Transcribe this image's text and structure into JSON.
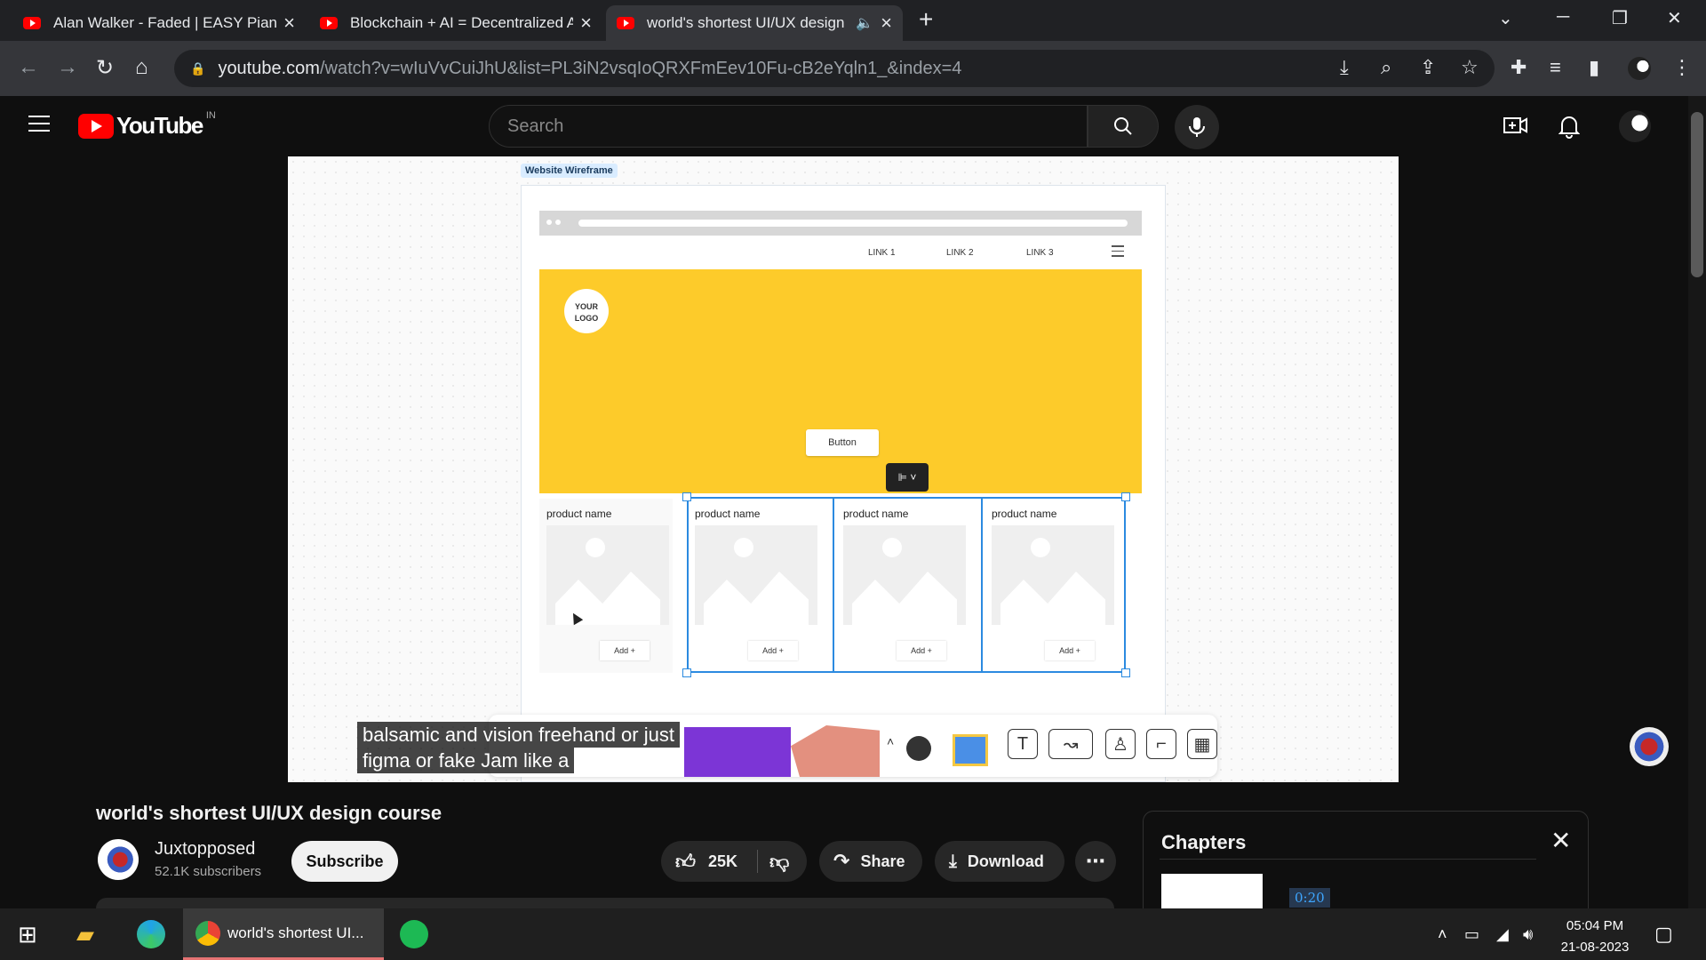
{
  "browser": {
    "tabs": [
      {
        "title": "Alan Walker - Faded | EASY Piano",
        "active": false
      },
      {
        "title": "Blockchain + AI = Decentralized A",
        "active": false
      },
      {
        "title": "world's shortest UI/UX design",
        "active": true
      }
    ],
    "new_tab": "+",
    "url_host": "youtube.com",
    "url_path": "/watch?v=wIuVvCuiJhU&list=PL3iN2vsqIoQRXFmEev10Fu-cB2eYqln1_&index=4"
  },
  "youtube": {
    "logo_text": "YouTube",
    "country": "IN",
    "search_placeholder": "Search"
  },
  "video": {
    "frame_tag": "Website Wireframe",
    "nav_links": [
      "LINK 1",
      "LINK 2",
      "LINK 3"
    ],
    "logo_line1": "YOUR",
    "logo_line2": "LOGO",
    "hero_button": "Button",
    "align_tool": "⊫ ˅",
    "products": [
      {
        "name": "product name",
        "add": "Add +"
      },
      {
        "name": "product name",
        "add": "Add +"
      },
      {
        "name": "product name",
        "add": "Add +"
      },
      {
        "name": "product name",
        "add": "Add +"
      }
    ],
    "captions": [
      "balsamic and vision freehand or just",
      "figma or fake Jam like a"
    ]
  },
  "meta": {
    "title": "world's shortest UI/UX design course",
    "channel": "Juxtopposed",
    "subscribers": "52.1K subscribers",
    "subscribe_label": "Subscribe",
    "likes": "25K",
    "share_label": "Share",
    "download_label": "Download"
  },
  "chapters": {
    "title": "Chapters",
    "first_time": "0:20"
  },
  "taskbar": {
    "chrome_title": "world's shortest UI...",
    "time": "05:04 PM",
    "date": "21-08-2023"
  },
  "colors": {
    "accent_red": "#ff0000",
    "hero_yellow": "#fdcb2a",
    "selection_blue": "#2b8ae0"
  }
}
